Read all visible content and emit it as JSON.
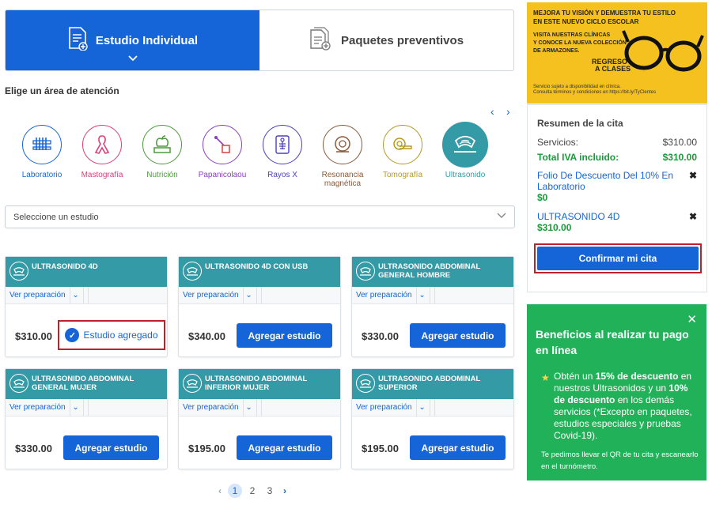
{
  "tabs": [
    {
      "label": "Estudio Individual",
      "icon": "document-add-icon",
      "active": true
    },
    {
      "label": "Paquetes preventivos",
      "icon": "documents-add-icon",
      "active": false
    }
  ],
  "area_title": "Elige un área de atención",
  "categories": [
    {
      "label": "Laboratorio",
      "color": "#1565d8",
      "icon": "test-tubes-icon"
    },
    {
      "label": "Mastografía",
      "color": "#d9407a",
      "icon": "pink-ribbon-icon"
    },
    {
      "label": "Nutrición",
      "color": "#4a9a3a",
      "icon": "apple-scale-icon"
    },
    {
      "label": "Papanicolaou",
      "color": "#8a3fbf",
      "icon": "swab-icon"
    },
    {
      "label": "Rayos X",
      "color": "#4b3fbf",
      "icon": "xray-icon"
    },
    {
      "label": "Resonancia magnética",
      "color": "#8a5a3a",
      "icon": "mri-icon"
    },
    {
      "label": "Tomografía",
      "color": "#b59a22",
      "icon": "ct-scanner-icon"
    },
    {
      "label": "Ultrasonido",
      "color": "#339aa6",
      "icon": "ultrasound-icon",
      "selected": true
    }
  ],
  "select": {
    "value": "Seleccione un estudio"
  },
  "prep_label": "Ver preparación",
  "add_label": "Agregar estudio",
  "added_label": "Estudio agregado",
  "cards": [
    {
      "title": "ULTRASONIDO 4D",
      "price": "$310.00",
      "added": true
    },
    {
      "title": "ULTRASONIDO 4D CON USB",
      "price": "$340.00",
      "added": false
    },
    {
      "title": "ULTRASONIDO ABDOMINAL GENERAL HOMBRE",
      "price": "$330.00",
      "added": false
    },
    {
      "title": "ULTRASONIDO ABDOMINAL GENERAL MUJER",
      "price": "$330.00",
      "added": false
    },
    {
      "title": "ULTRASONIDO ABDOMINAL INFERIOR MUJER",
      "price": "$195.00",
      "added": false
    },
    {
      "title": "ULTRASONIDO ABDOMINAL SUPERIOR",
      "price": "$195.00",
      "added": false
    }
  ],
  "pager": {
    "pages": [
      "1",
      "2",
      "3"
    ],
    "current": "1"
  },
  "banner": {
    "line1": "MEJORA TU VISIÓN Y DEMUESTRA TU ESTILO",
    "line2": "EN ESTE NUEVO CICLO ESCOLAR",
    "line3": "VISITA NUESTRAS CLÍNICAS",
    "line4": "Y CONOCE LA NUEVA COLECCIÓN",
    "line5": "DE ARMAZONES.",
    "logo1": "REGRESO",
    "logo2": "A CLASES",
    "fine1": "Servicio sujeto a disponibilidad en clínica.",
    "fine2": "Consulta términos y condiciones en https://bit.ly/TyClentes"
  },
  "summary": {
    "title": "Resumen de la cita",
    "services_label": "Servicios:",
    "services_value": "$310.00",
    "total_label": "Total IVA incluido:",
    "total_value": "$310.00",
    "items": [
      {
        "name": "Folio De Descuento Del 10% En Laboratorio",
        "price": "$0"
      },
      {
        "name": "ULTRASONIDO 4D",
        "price": "$310.00"
      }
    ],
    "confirm_label": "Confirmar mi cita"
  },
  "benefits": {
    "title": "Beneficios al realizar tu pago en línea",
    "t1": "Obtén un ",
    "b1": "15% de descuento",
    "t2": " en nuestros Ultrasonidos y un ",
    "b2": "10% de descuento",
    "t3": " en los demás servicios (*Excepto en paquetes, estudios especiales y pruebas Covid-19).",
    "note": "Te pedimos llevar el QR de tu cita y escanearlo en el turnómetro."
  },
  "colors": {
    "primary": "#1565d8",
    "teal": "#339aa6",
    "green": "#21b159",
    "alert": "#c0202a",
    "banner": "#f4c11f"
  }
}
